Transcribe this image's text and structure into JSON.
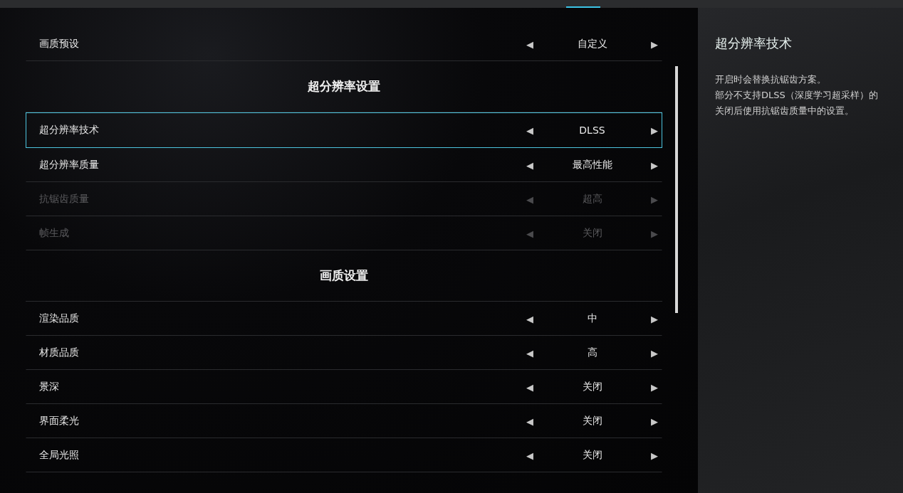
{
  "settings": [
    {
      "kind": "row",
      "label": "画质预设",
      "value": "自定义",
      "left_arrow": "◀",
      "right_arrow": "▶",
      "selected": false,
      "disabled": false
    },
    {
      "kind": "header",
      "label": "超分辨率设置"
    },
    {
      "kind": "row",
      "label": "超分辨率技术",
      "value": "DLSS",
      "left_arrow": "◀",
      "right_arrow": "▶",
      "selected": true,
      "disabled": false
    },
    {
      "kind": "row",
      "label": "超分辨率质量",
      "value": "最高性能",
      "left_arrow": "◀",
      "right_arrow": "▶",
      "selected": false,
      "disabled": false
    },
    {
      "kind": "row",
      "label": "抗锯齿质量",
      "value": "超高",
      "left_arrow": "◀",
      "right_arrow": "▶",
      "selected": false,
      "disabled": true
    },
    {
      "kind": "row",
      "label": "帧生成",
      "value": "关闭",
      "left_arrow": "◀",
      "right_arrow": "▶",
      "selected": false,
      "disabled": true
    },
    {
      "kind": "header",
      "label": "画质设置"
    },
    {
      "kind": "row",
      "label": "渲染品质",
      "value": "中",
      "left_arrow": "◀",
      "right_arrow": "▶",
      "selected": false,
      "disabled": false
    },
    {
      "kind": "row",
      "label": "材质品质",
      "value": "高",
      "left_arrow": "◀",
      "right_arrow": "▶",
      "selected": false,
      "disabled": false
    },
    {
      "kind": "row",
      "label": "景深",
      "value": "关闭",
      "left_arrow": "◀",
      "right_arrow": "▶",
      "selected": false,
      "disabled": false
    },
    {
      "kind": "row",
      "label": "界面柔光",
      "value": "关闭",
      "left_arrow": "◀",
      "right_arrow": "▶",
      "selected": false,
      "disabled": false
    },
    {
      "kind": "row",
      "label": "全局光照",
      "value": "关闭",
      "left_arrow": "◀",
      "right_arrow": "▶",
      "selected": false,
      "disabled": false
    }
  ],
  "description": {
    "title": "超分辨率技术",
    "lines": [
      "开启时会替换抗锯齿方案。",
      "部分不支持DLSS（深度学习超采样）的",
      "关闭后使用抗锯齿质量中的设置。"
    ]
  }
}
